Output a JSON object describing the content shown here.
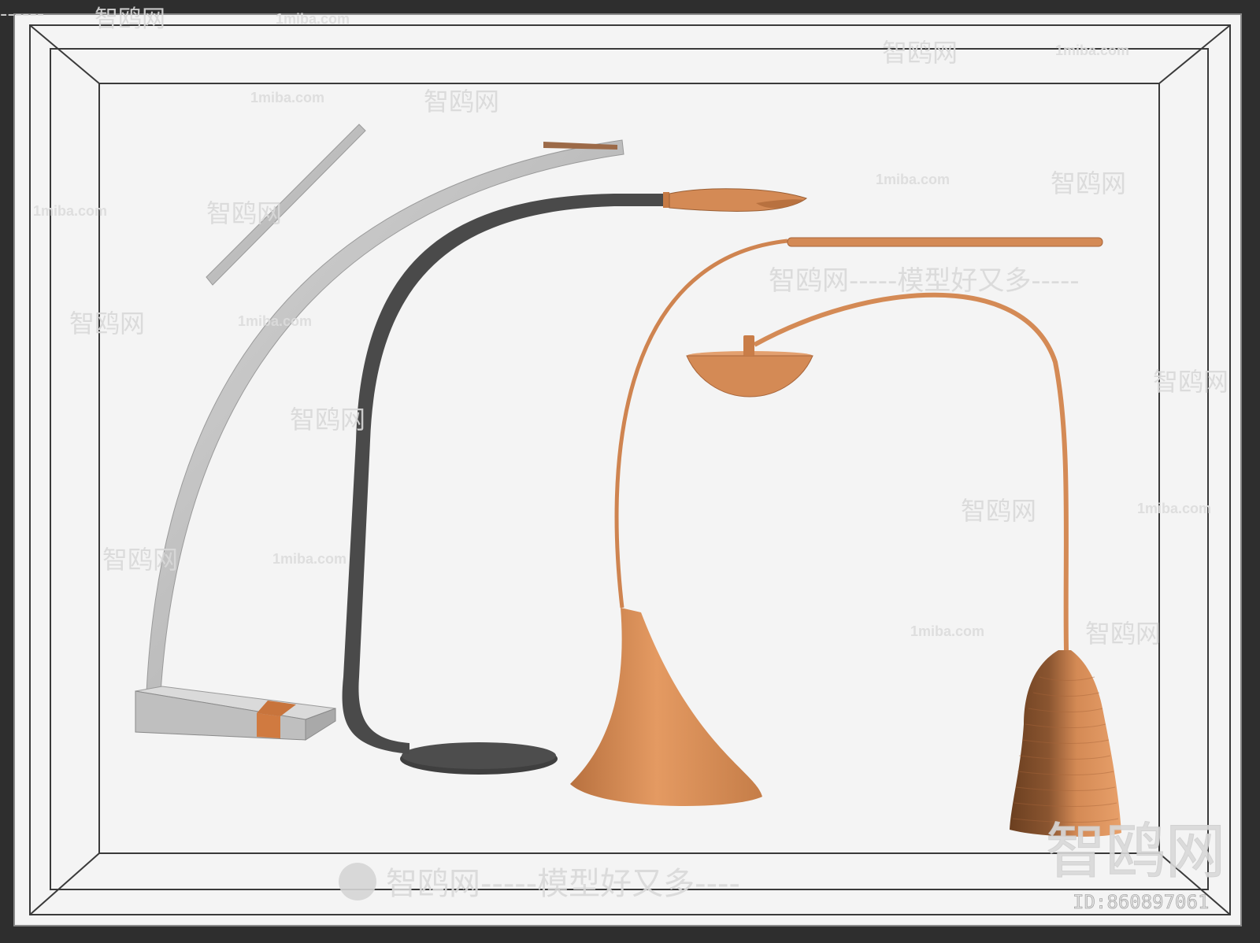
{
  "watermarks": {
    "site_cn": "智鸥网",
    "site_en": "1miba.com",
    "dash": "------",
    "slogan": "智鸥网-----模型好又多----",
    "slogan_mid": "智鸥网-----模型好又多-----",
    "big_logo": "智鸥网",
    "id_label": "ID:860897061"
  },
  "objects": {
    "lamp1": "concrete-arc-floor-lamp",
    "lamp2": "dark-grey-curved-floor-lamp",
    "lamp3": "orange-cone-base-floor-lamp",
    "lamp4": "orange-arch-pendant-floor-lamp"
  },
  "colors": {
    "background_outer": "#2e2e2e",
    "viewport": "#f4f4f4",
    "concrete": "#c9c9c9",
    "dark_lamp": "#4a4a4a",
    "orange": "#d48a55",
    "orange_dark": "#8a5530"
  }
}
